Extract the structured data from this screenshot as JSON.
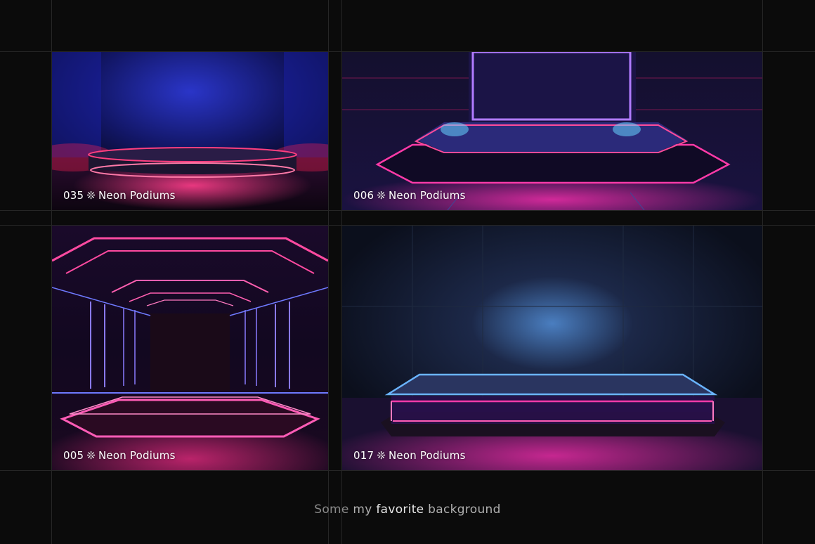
{
  "cards": [
    {
      "number": "035",
      "separator": "❊",
      "title": "Neon Podiums"
    },
    {
      "number": "006",
      "separator": "❊",
      "title": "Neon Podiums"
    },
    {
      "number": "005",
      "separator": "❊",
      "title": "Neon Podiums"
    },
    {
      "number": "017",
      "separator": "❊",
      "title": "Neon Podiums"
    }
  ],
  "caption": {
    "part1": "Some",
    "part2": "my",
    "part3": "favorite",
    "part4": "background"
  },
  "colors": {
    "background": "#0b0b0b",
    "gridline": "#262626",
    "neon_pink": "#ff2fa0",
    "neon_blue": "#5a4dff"
  }
}
